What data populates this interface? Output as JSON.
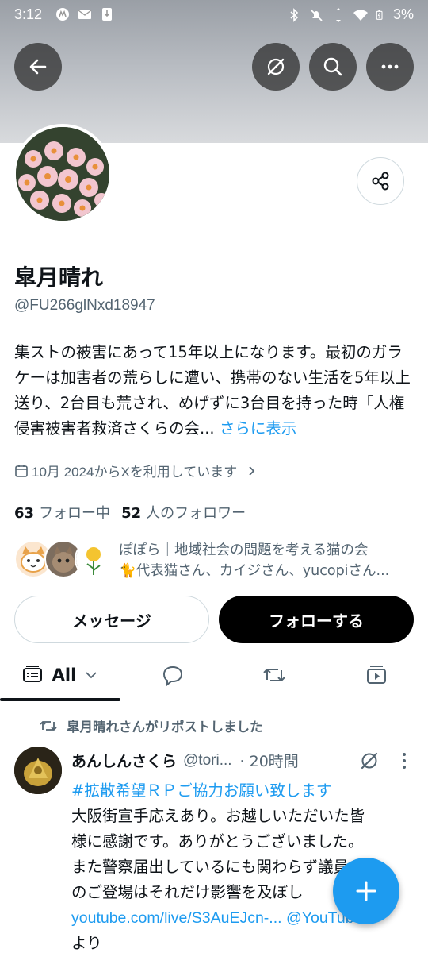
{
  "status_bar": {
    "time": "3:12",
    "battery": "3%",
    "left_icons": [
      "app-m-icon",
      "mail-icon",
      "download-icon"
    ],
    "right_icons": [
      "bluetooth-icon",
      "mute-icon",
      "data-arrows-icon",
      "wifi-icon",
      "battery-icon"
    ]
  },
  "header": {
    "back_icon": "arrow-left-icon",
    "actions": [
      "grok-icon",
      "search-icon",
      "more-icon"
    ]
  },
  "profile": {
    "name": "皐月晴れ",
    "handle": "@FU266glNxd18947",
    "bio": "集ストの被害にあって15年以上になります。最初のガラケーは加害者の荒らしに遭い、携帯のない生活を5年以上送り、2台目も荒され、めげずに3台目を持った時「人権侵害被害者救済さくらの会...",
    "bio_more": "さらに表示",
    "joined": "10月 2024からXを利用しています",
    "following_count": "63",
    "following_label": "フォロー中",
    "followers_count": "52",
    "followers_label": "人のフォロワー",
    "known_followers_line1": "ぽぽら｜地域社会の問題を考える猫の会",
    "known_followers_line2": "🐈代表猫さん、カイジさん、yucopiさん...",
    "message_button": "メッセージ",
    "follow_button": "フォローする"
  },
  "tabs": {
    "all_label": "All",
    "items": [
      "all-feed-icon",
      "reply-icon",
      "repost-icon",
      "media-icon"
    ]
  },
  "tweet": {
    "repost_text": "皐月晴れさんがリポストしました",
    "author_name": "あんしんさくら",
    "author_handle": "@tori...",
    "time": "· 20時間",
    "hashtag_line": "#拡散希望ＲＰご協力お願い致します",
    "body_line1": "大阪街宣手応えあり。お越しいただいた皆",
    "body_line2": "様に感謝です。ありがとうございました。",
    "body_line3": "また警察届出しているにも関わらず議員",
    "body_line4": "のご登場はそれだけ影響を及ぼし",
    "link": "youtube.com/live/S3AuEJcn-...",
    "link_suffix": " @YouTube",
    "body_line5": "より"
  },
  "colors": {
    "accent": "#1d9bf0",
    "text": "#0f1419",
    "secondary": "#536471"
  }
}
